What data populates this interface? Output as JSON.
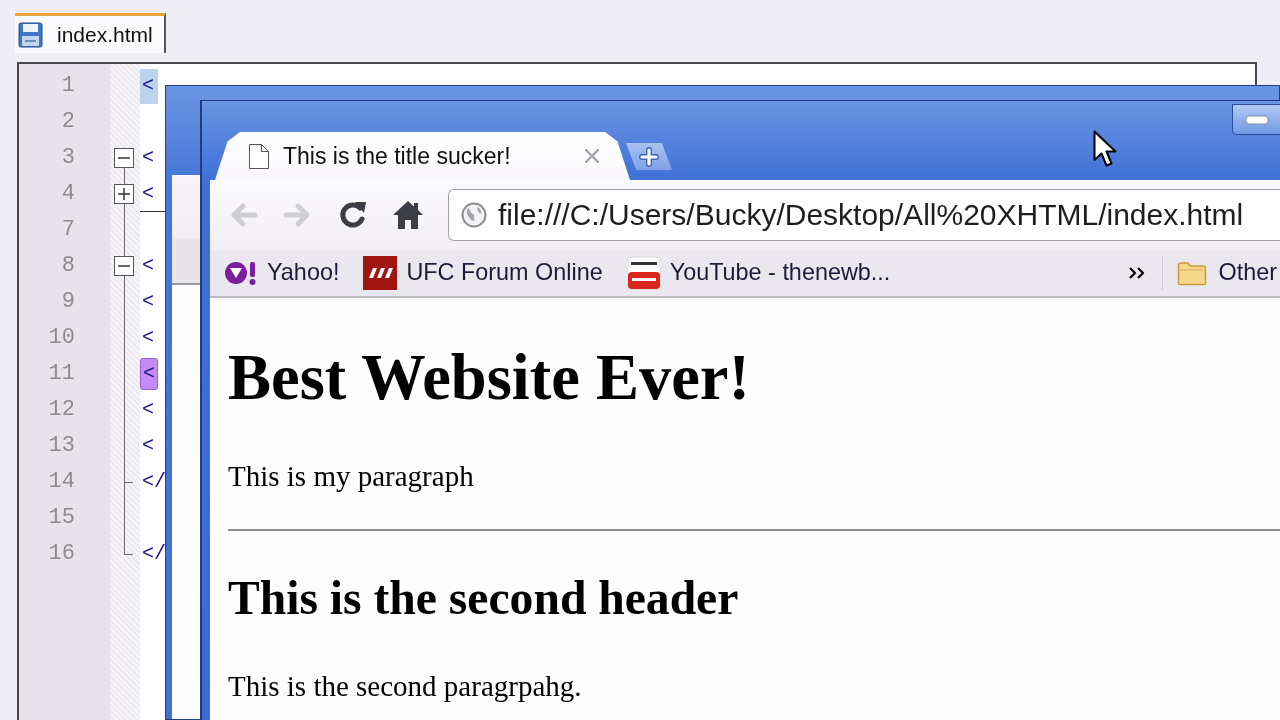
{
  "editor": {
    "tabs": [
      {
        "label": "index.html",
        "selected": true
      }
    ],
    "lines": [
      {
        "number": "1",
        "code": "<",
        "selected": true,
        "marked": false
      },
      {
        "number": "2",
        "selected": false,
        "marked": false
      },
      {
        "number": "3",
        "code": "<",
        "selected": false,
        "marked": false,
        "expanded": true,
        "children": [
          {
            "number": "4",
            "code": "<",
            "selected": false,
            "marked": false,
            "expanded": false
          },
          {
            "number": "7",
            "selected": false,
            "marked": false
          },
          {
            "number": "8",
            "code": "<",
            "selected": false,
            "marked": false,
            "expanded": true,
            "children": [
              {
                "number": "9",
                "code": "<",
                "selected": false,
                "marked": false
              },
              {
                "number": "10",
                "code": "<",
                "selected": false,
                "marked": false
              },
              {
                "number": "11",
                "code": "<",
                "selected": false,
                "marked": true
              },
              {
                "number": "12",
                "code": "<",
                "selected": false,
                "marked": false
              },
              {
                "number": "13",
                "code": "<",
                "selected": false,
                "marked": false
              },
              {
                "number": "14",
                "code": "</",
                "selected": false,
                "marked": false
              }
            ]
          },
          {
            "number": "15",
            "selected": false,
            "marked": false
          },
          {
            "number": "16",
            "code": "</",
            "selected": false,
            "marked": false
          }
        ]
      }
    ]
  },
  "browser": {
    "tabs": [
      {
        "title": "This is the title sucker!",
        "selected": true
      }
    ],
    "nav_buttons": [
      {
        "kind": "back",
        "disabled": true
      },
      {
        "kind": "forward",
        "disabled": true
      },
      {
        "kind": "reload",
        "disabled": false
      },
      {
        "kind": "home",
        "disabled": false
      }
    ],
    "address_bar": {
      "value": "file:///C:/Users/Bucky/Desktop/All%20XHTML/index.html"
    },
    "bookmarks": [
      {
        "kind": "purple-circle",
        "label": "Yahoo!"
      },
      {
        "kind": "red-square",
        "label": "UFC Forum Online"
      },
      {
        "kind": "red-tile",
        "label": "YouTube - thenewb..."
      }
    ],
    "other_bookmarks": {
      "label": "Other"
    },
    "page": [
      {
        "kind": "h1",
        "text": "Best Website Ever!"
      },
      {
        "kind": "paragraph",
        "text": "This is my paragraph"
      },
      {
        "kind": "rule"
      },
      {
        "kind": "h2",
        "text": "This is the second header"
      },
      {
        "kind": "paragraph",
        "text": "This is the second paragrpahg."
      }
    ]
  }
}
